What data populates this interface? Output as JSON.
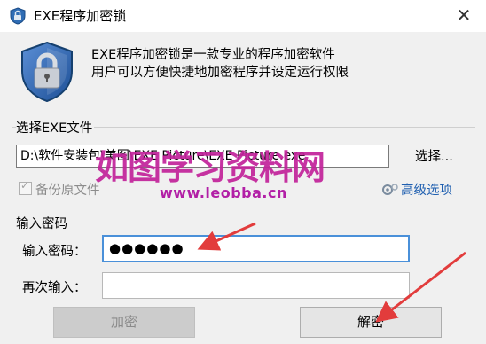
{
  "window": {
    "title": "EXE程序加密锁"
  },
  "header": {
    "description_line1": "EXE程序加密锁是一款专业的程序加密软件",
    "description_line2": "用户可以方便快捷地加密程序并设定运行权限"
  },
  "file_group": {
    "label": "选择EXE文件",
    "path_value": "D:\\软件安装包\\美图\\EXE Picture\\EXE Picture.exe",
    "browse_label": "选择...",
    "backup_label": "备份原文件",
    "backup_checked": true,
    "advanced_label": "高级选项"
  },
  "password_group": {
    "label": "输入密码",
    "password_label": "输入密码：",
    "password_value": "●●●●●●",
    "confirm_label": "再次输入：",
    "confirm_value": ""
  },
  "buttons": {
    "encrypt": "加密",
    "decrypt": "解密"
  },
  "watermark": {
    "text": "如图学习资料网",
    "url": "www.leobba.cn"
  },
  "colors": {
    "accent": "#4a90d9",
    "link": "#1f5fb0",
    "arrow": "#e23c3c",
    "watermark": "#c2249b"
  },
  "icons": [
    "app-lock-icon",
    "shield-lock-icon",
    "close-icon",
    "checkbox-icon",
    "advanced-options-icon"
  ]
}
